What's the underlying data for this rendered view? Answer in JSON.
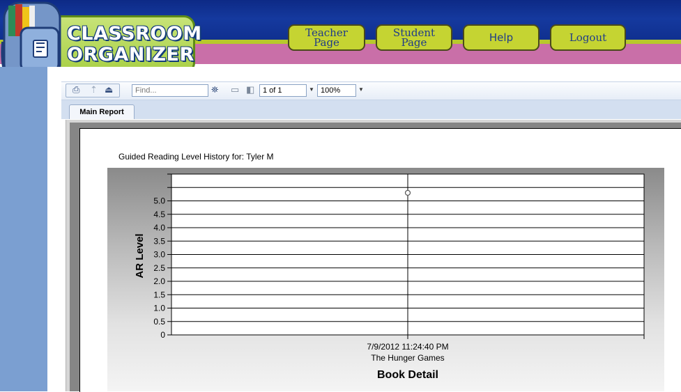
{
  "header": {
    "logo_line1": "CLASSROOM",
    "logo_line2": "ORGANIZER",
    "nav": [
      {
        "line1": "Teacher",
        "line2": "Page"
      },
      {
        "line1": "Student",
        "line2": "Page"
      },
      {
        "line1": "Help",
        "line2": ""
      },
      {
        "line1": "Logout",
        "line2": ""
      }
    ]
  },
  "toolbar": {
    "icons": [
      "print-icon",
      "export-icon",
      "upload-icon",
      "binoculars-icon",
      "first-page-icon",
      "prev-page-icon"
    ],
    "find_placeholder": "Find...",
    "page_value": "1 of 1",
    "zoom_value": "100%"
  },
  "tabs": [
    {
      "label": "Main Report"
    }
  ],
  "report": {
    "heading": "Guided Reading Level History for:  Tyler M"
  },
  "chart_data": {
    "type": "line",
    "title": "",
    "ylabel": "AR Level",
    "xlabel": "Book Detail",
    "ylim": [
      0,
      6
    ],
    "y_ticks": [
      "0",
      "0.5",
      "1.0",
      "1.5",
      "2.0",
      "2.5",
      "3.0",
      "3.5",
      "4.0",
      "4.5",
      "5.0"
    ],
    "x_categories": [
      {
        "date": "7/9/2012 11:24:40 PM",
        "book": "The Hunger Games"
      }
    ],
    "series": [
      {
        "values": [
          5.3
        ]
      }
    ],
    "grid": true,
    "legend": "none"
  }
}
